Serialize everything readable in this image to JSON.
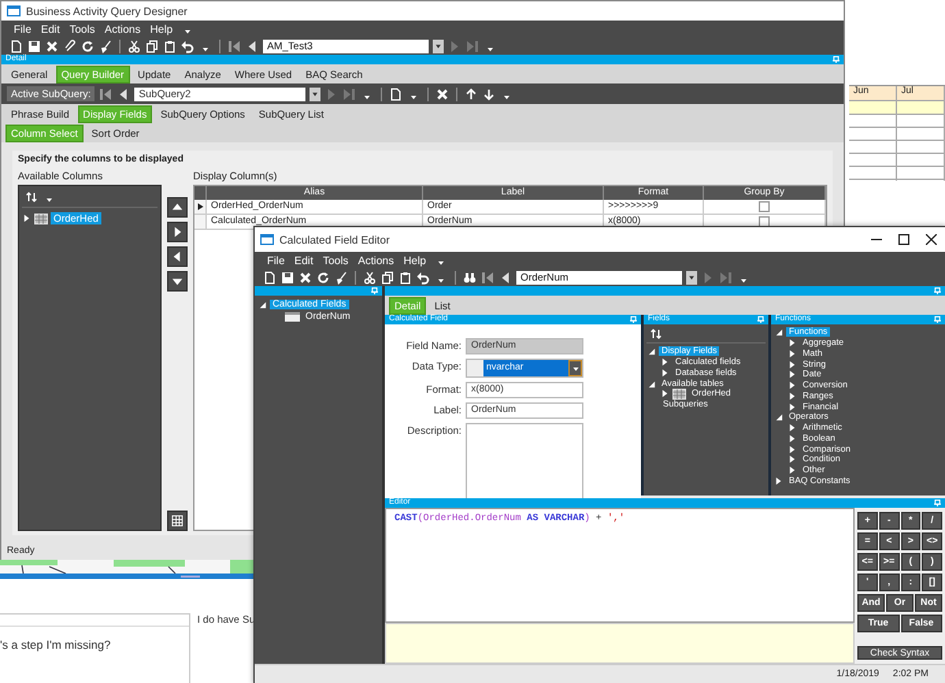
{
  "background_sheet": {
    "columns": [
      "Jun",
      "Jul"
    ]
  },
  "main_window": {
    "title": "Business Activity Query Designer",
    "menu": [
      "File",
      "Edit",
      "Tools",
      "Actions",
      "Help"
    ],
    "record": "AM_Test3",
    "panel_title": "Detail",
    "tabs": [
      {
        "label": "General",
        "selected": false
      },
      {
        "label": "Query Builder",
        "selected": true
      },
      {
        "label": "Update",
        "selected": false
      },
      {
        "label": "Analyze",
        "selected": false
      },
      {
        "label": "Where Used",
        "selected": false
      },
      {
        "label": "BAQ Search",
        "selected": false
      }
    ],
    "subquery_label": "Active SubQuery:",
    "subquery": "SubQuery2",
    "subtabs": [
      {
        "label": "Phrase Build",
        "selected": false
      },
      {
        "label": "Display Fields",
        "selected": true
      },
      {
        "label": "SubQuery Options",
        "selected": false
      },
      {
        "label": "SubQuery List",
        "selected": false
      }
    ],
    "view_tabs": [
      {
        "label": "Column Select",
        "selected": true
      },
      {
        "label": "Sort Order",
        "selected": false
      }
    ],
    "instruction": "Specify the columns to be displayed",
    "available_label": "Available Columns",
    "available_tree": [
      {
        "label": "OrderHed",
        "selected": true,
        "expanded": false,
        "kind": "table"
      }
    ],
    "display_label": "Display Column(s)",
    "table": {
      "columns": [
        "Alias",
        "Label",
        "Format",
        "Group By"
      ],
      "rows": [
        {
          "alias": "OrderHed_OrderNum",
          "label": "Order",
          "format": ">>>>>>>>9",
          "group_by": false,
          "current": true
        },
        {
          "alias": "Calculated_OrderNum",
          "label": "OrderNum",
          "format": "x(8000)",
          "group_by": false,
          "current": false
        }
      ]
    },
    "status": "Ready"
  },
  "background_page": {
    "side_text": "I do have Su",
    "reply_text": "'s a step I'm missing?"
  },
  "editor_window": {
    "title": "Calculated Field Editor",
    "menu": [
      "File",
      "Edit",
      "Tools",
      "Actions",
      "Help"
    ],
    "record": "OrderNum",
    "tree": [
      {
        "label": "Calculated Fields",
        "selected": true,
        "expanded": true,
        "children": [
          {
            "label": "OrderNum",
            "selected": false,
            "kind": "field"
          }
        ]
      }
    ],
    "tabs": [
      {
        "label": "Detail",
        "selected": true
      },
      {
        "label": "List",
        "selected": false
      }
    ],
    "field_panel": {
      "title": "Calculated Field",
      "fields": [
        {
          "label": "Field Name:",
          "value": "OrderNum",
          "kind": "readonly"
        },
        {
          "label": "Data Type:",
          "value": "nvarchar",
          "kind": "dropdown"
        },
        {
          "label": "Format:",
          "value": "x(8000)",
          "kind": "text"
        },
        {
          "label": "Label:",
          "value": "OrderNum",
          "kind": "text"
        },
        {
          "label": "Description:",
          "kind": "textarea"
        }
      ]
    },
    "fields_panel": {
      "title": "Fields",
      "tree": [
        {
          "label": "Display Fields",
          "selected": true,
          "expanded": true,
          "children": [
            {
              "label": "Calculated fields",
              "selected": false,
              "expanded": false
            },
            {
              "label": "Database fields",
              "selected": false,
              "expanded": false
            }
          ]
        },
        {
          "label": "Available tables",
          "selected": false,
          "expanded": true,
          "children": [
            {
              "label": "OrderHed",
              "selected": false,
              "expanded": false,
              "kind": "table"
            }
          ]
        },
        {
          "label": "Subqueries",
          "selected": false
        }
      ]
    },
    "functions_panel": {
      "title": "Functions",
      "tree": [
        {
          "label": "Functions",
          "selected": true,
          "expanded": true,
          "children": [
            {
              "label": "Aggregate",
              "selected": false,
              "expanded": false
            },
            {
              "label": "Math",
              "selected": false,
              "expanded": false
            },
            {
              "label": "String",
              "selected": false,
              "expanded": false
            },
            {
              "label": "Date",
              "selected": false,
              "expanded": false
            },
            {
              "label": "Conversion",
              "selected": false,
              "expanded": false
            },
            {
              "label": "Ranges",
              "selected": false,
              "expanded": false
            },
            {
              "label": "Financial",
              "selected": false,
              "expanded": false
            }
          ]
        },
        {
          "label": "Operators",
          "selected": false,
          "expanded": true,
          "children": [
            {
              "label": "Arithmetic",
              "selected": false,
              "expanded": false
            },
            {
              "label": "Boolean",
              "selected": false,
              "expanded": false
            },
            {
              "label": "Comparison",
              "selected": false,
              "expanded": false
            },
            {
              "label": "Condition",
              "selected": false,
              "expanded": false
            },
            {
              "label": "Other",
              "selected": false,
              "expanded": false
            }
          ]
        },
        {
          "label": "BAQ Constants",
          "selected": false,
          "expanded": false
        }
      ]
    },
    "editor": {
      "title": "Editor",
      "code": [
        {
          "text": "CAST",
          "kind": "keyword"
        },
        {
          "text": "(",
          "kind": "field"
        },
        {
          "text": "OrderHed",
          "kind": "field"
        },
        {
          "text": ".",
          "kind": "field"
        },
        {
          "text": "OrderNum",
          "kind": "field"
        },
        {
          "text": " AS VARCHAR",
          "kind": "keyword"
        },
        {
          "text": ")",
          "kind": "field"
        },
        {
          "text": " + ",
          "kind": "operator"
        },
        {
          "text": "','",
          "kind": "string"
        }
      ]
    },
    "keypad": [
      [
        "+",
        "-",
        "*",
        "/"
      ],
      [
        "=",
        "<",
        ">",
        "<>"
      ],
      [
        "<=",
        ">=",
        "(",
        ")"
      ],
      [
        "'",
        ",",
        ":",
        "[]"
      ],
      [
        "And",
        "Or",
        "Not"
      ],
      [
        "True",
        "False"
      ]
    ],
    "check_button": "Check Syntax",
    "status": {
      "date": "1/18/2019",
      "time": "2:02 PM"
    }
  }
}
